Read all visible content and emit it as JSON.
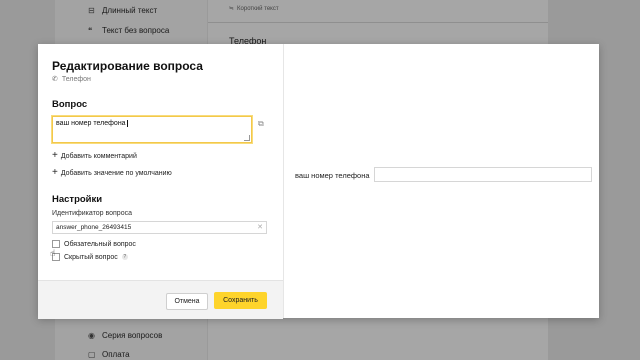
{
  "background": {
    "sidebar_items": [
      {
        "icon": "long-text-icon",
        "glyph": "⊟",
        "label": "Длинный текст"
      },
      {
        "icon": "quote-icon",
        "glyph": "❝",
        "label": "Текст без вопроса"
      },
      {
        "icon": "series-icon",
        "glyph": "◉",
        "label": "Серия вопросов"
      },
      {
        "icon": "payment-icon",
        "glyph": "▢",
        "label": "Оплата"
      }
    ],
    "card_hint": "Короткий текст",
    "card_title": "Телефон"
  },
  "modal": {
    "title": "Редактирование вопроса",
    "subtitle": "Телефон",
    "question_section": "Вопрос",
    "question_value": "ваш номер телефона",
    "add_comment": "Добавить комментарий",
    "add_default": "Добавить значение по умолчанию",
    "settings_section": "Настройки",
    "id_label": "Идентификатор вопроса",
    "id_value": "answer_phone_26493415",
    "required_label": "Обязательный вопрос",
    "hidden_label": "Скрытый вопрос",
    "hidden_hint": "?",
    "cancel": "Отмена",
    "save": "Сохранить"
  },
  "preview": {
    "label": "ваш номер телефона"
  },
  "colors": {
    "accent": "#fed42b",
    "focus_border": "#f3c84b"
  }
}
